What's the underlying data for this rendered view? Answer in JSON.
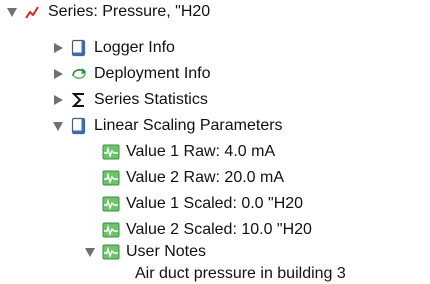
{
  "tree": {
    "root": {
      "label": "Series: Pressure, \"H20",
      "icon": "series-line-icon",
      "expanded": true
    },
    "children": [
      {
        "label": "Logger Info",
        "icon": "logger-doc-icon",
        "expanded": false
      },
      {
        "label": "Deployment Info",
        "icon": "deployment-cycle-icon",
        "expanded": false
      },
      {
        "label": "Series Statistics",
        "icon": "sigma-icon",
        "expanded": false
      },
      {
        "label": "Linear Scaling Parameters",
        "icon": "logger-doc-icon",
        "expanded": true
      }
    ],
    "scaling_items": [
      {
        "label": "Value 1 Raw: 4.0 mA",
        "icon": "value-box-icon"
      },
      {
        "label": "Value 2 Raw: 20.0 mA",
        "icon": "value-box-icon"
      },
      {
        "label": "Value 1 Scaled: 0.0 \"H20",
        "icon": "value-box-icon"
      },
      {
        "label": "Value 2 Scaled: 10.0 \"H20",
        "icon": "value-box-icon"
      }
    ],
    "user_notes": {
      "label": "User Notes",
      "icon": "value-box-icon",
      "expanded": true,
      "note": "Air duct pressure in building 3"
    }
  }
}
